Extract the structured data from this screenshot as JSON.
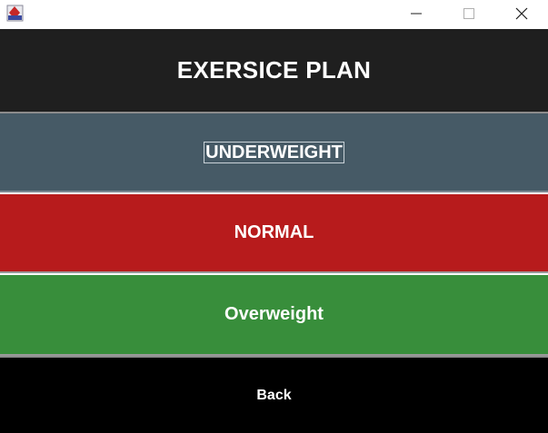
{
  "window": {
    "icon": "java-app-icon",
    "controls": {
      "minimize_icon": "minimize-icon",
      "maximize_icon": "maximize-icon",
      "close_icon": "close-icon"
    }
  },
  "header": {
    "title": "EXERSICE PLAN"
  },
  "buttons": {
    "underweight": "UNDERWEIGHT",
    "normal": "NORMAL",
    "overweight": "Overweight",
    "back": "Back"
  },
  "colors": {
    "header_bg": "#1f1f1f",
    "underweight_bg": "#465a66",
    "normal_bg": "#b71b1c",
    "overweight_bg": "#388e3b",
    "back_bg": "#000000"
  }
}
